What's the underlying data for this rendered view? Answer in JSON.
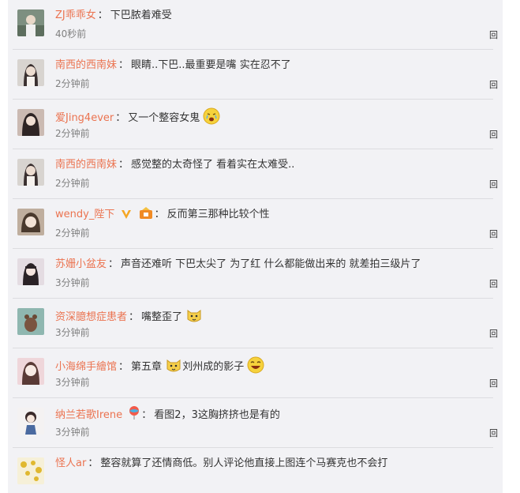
{
  "comments": [
    {
      "user": "ZJ乖乖女",
      "text": "下巴脓着难受",
      "time": "40秒前",
      "avatar_color": "#8a9a8c"
    },
    {
      "user": "南西的西南妹",
      "text": "眼睛..下巴..最重要是嘴 实在忍不了",
      "time": "2分钟前",
      "avatar_color": "#d8d4d0"
    },
    {
      "user": "爱Jing4ever",
      "text": "又一个整容女鬼",
      "time": "2分钟前",
      "avatar_color": "#c9b8b0"
    },
    {
      "user": "南西的西南妹",
      "text": "感觉整的太奇怪了 看着实在太难受..",
      "time": "2分钟前",
      "avatar_color": "#d8d4d0"
    },
    {
      "user": "wendy_陛下",
      "text": "反而第三那种比较个性",
      "time": "2分钟前",
      "avatar_color": "#b9a898"
    },
    {
      "user": "苏姗小盆友",
      "text": "声音还难听 下巴太尖了 为了红 什么都能做出来的 就差拍三级片了",
      "time": "3分钟前",
      "avatar_color": "#cfc7cc"
    },
    {
      "user": "资深臆想症患者",
      "text": "嘴整歪了",
      "time": "3分钟前",
      "avatar_color": "#8fb7b0"
    },
    {
      "user": "小海绵手繪馆",
      "text": "第五章",
      "text2": "刘州成的影子",
      "time": "3分钟前",
      "avatar_color": "#e6c8cc"
    },
    {
      "user": "纳兰若歌Irene",
      "text": "看图2，3这胸挤挤也是有的",
      "time": "3分钟前",
      "avatar_color": "#f0eeee"
    },
    {
      "user": "怪人ar",
      "text": "整容就算了还情商低。别人评论他直接上图连个马赛克也不会打",
      "time": "",
      "avatar_color": "#f2e6b0"
    }
  ],
  "colon": "：",
  "reply_icon": "回",
  "icons": {
    "emoji_cry": "crying-face-emoji-icon",
    "emoji_cat": "cat-face-emoji-icon",
    "emoji_laugh": "laughing-face-emoji-icon",
    "verified_v": "verified-v-icon",
    "vip_badge": "vip-badge-icon",
    "balloon": "balloon-icon"
  },
  "colors": {
    "username": "#eb7350",
    "time": "#808080",
    "panel_bg": "#f2f2f5"
  }
}
